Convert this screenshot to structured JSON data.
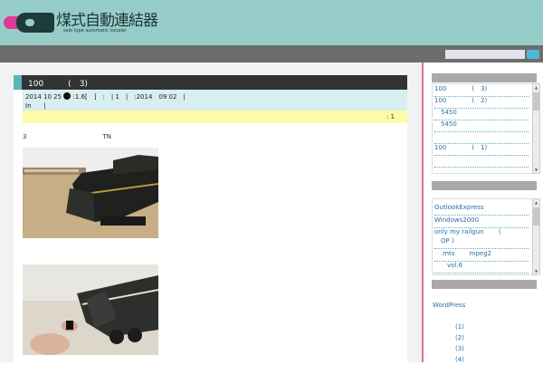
{
  "header": {
    "title": "煤式自動連結器",
    "subtitle": "solo type automatic coupler"
  },
  "colors": {
    "header_bg": "#97cdc9",
    "topbar_bg": "#6d6d6d",
    "accent_teal": "#58b7b6",
    "accent_pink": "#e0399a",
    "link_blue": "#2a6fa3",
    "notice_yellow": "#fdfca6"
  },
  "search": {
    "placeholder": "",
    "button_icon": "search-icon"
  },
  "post": {
    "title": "100　　　(　3)",
    "meta_line1_a": "2014 10 25 ",
    "meta_line1_b": " :1.6[　]　:　| 1　|　:2014　09 02　|",
    "meta_line2": "In　　|",
    "notice": ": 1",
    "body_text": "3　　　　　　　　　　　　TN"
  },
  "sidebar": {
    "recent": [
      "100　　　　(　3)",
      "100　　　　(　2)",
      "　5450",
      "　5450",
      "",
      "100　　　　(　1)",
      ""
    ],
    "categories": [
      "OutlookExpress",
      "Windows2000",
      "only my railgun　　 (",
      "　OP )",
      "　.mts　　 mpeg2",
      "　　vol.6"
    ],
    "wordpress_label": "WordPress",
    "archives": [
      "(1)",
      "(2)",
      "(3)",
      "(4)"
    ]
  }
}
